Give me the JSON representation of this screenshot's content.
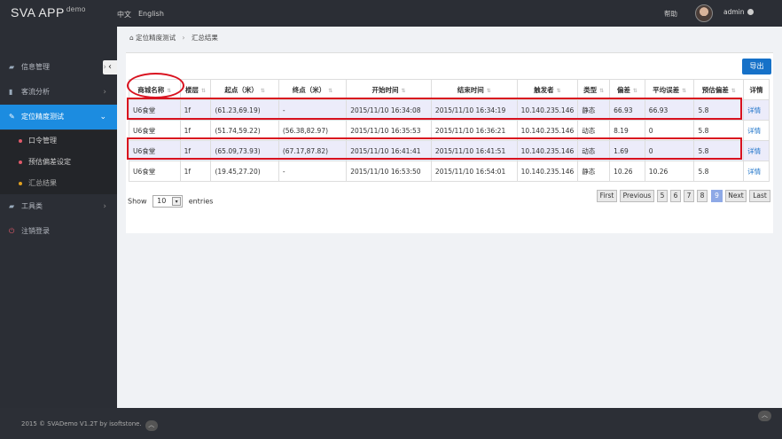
{
  "app": {
    "logo": "SVA APP",
    "logo_sup": "demo"
  },
  "topbar": {
    "lang_zh": "中文",
    "lang_en": "English",
    "help": "帮助",
    "user": "admin"
  },
  "sidebar": {
    "collapse_icon": "‹",
    "items": [
      {
        "label": "信息管理",
        "icon": "folder-icon"
      },
      {
        "label": "客流分析",
        "icon": "bar-chart-icon"
      },
      {
        "label": "定位精度测试",
        "icon": "edit-icon"
      },
      {
        "label": "工具类",
        "icon": "folder-icon"
      },
      {
        "label": "注销登录",
        "icon": "power-icon"
      }
    ],
    "subitems": [
      {
        "label": "口令管理",
        "dot": "#e05a6a"
      },
      {
        "label": "预估偏差设定",
        "dot": "#e05a6a"
      },
      {
        "label": "汇总结果",
        "dot": "#e0a020"
      }
    ]
  },
  "breadcrumb": {
    "home": "定位精度测试",
    "current": "汇总结果"
  },
  "toolbar": {
    "export": "导出"
  },
  "table": {
    "headers": [
      "商城名称",
      "楼层",
      "起点（米）",
      "终点（米）",
      "开始时间",
      "结束时间",
      "触发者",
      "类型",
      "偏差",
      "平均误差",
      "预估偏差",
      "详情"
    ],
    "rows": [
      [
        "U6食堂",
        "1f",
        "(61.23,69.19)",
        "-",
        "2015/11/10 16:34:08",
        "2015/11/10 16:34:19",
        "10.140.235.146",
        "静态",
        "66.93",
        "66.93",
        "5.8",
        "详情"
      ],
      [
        "U6食堂",
        "1f",
        "(51.74,59.22)",
        "(56.38,82.97)",
        "2015/11/10 16:35:53",
        "2015/11/10 16:36:21",
        "10.140.235.146",
        "动态",
        "8.19",
        "0",
        "5.8",
        "详情"
      ],
      [
        "U6食堂",
        "1f",
        "(65.09,73.93)",
        "(67.17,87.82)",
        "2015/11/10 16:41:41",
        "2015/11/10 16:41:51",
        "10.140.235.146",
        "动态",
        "1.69",
        "0",
        "5.8",
        "详情"
      ],
      [
        "U6食堂",
        "1f",
        "(19.45,27.20)",
        "-",
        "2015/11/10 16:53:50",
        "2015/11/10 16:54:01",
        "10.140.235.146",
        "静态",
        "10.26",
        "10.26",
        "5.8",
        "详情"
      ]
    ]
  },
  "length": {
    "show": "Show",
    "value": "10",
    "entries": "entries"
  },
  "pagination": {
    "first": "First",
    "previous": "Previous",
    "pages": [
      "5",
      "6",
      "7",
      "8",
      "9"
    ],
    "current": "9",
    "next": "Next",
    "last": "Last"
  },
  "footer": {
    "text": "2015 © SVADemo V1.2T by isoftstone."
  },
  "colors": {
    "accent": "#1c8ce0",
    "export": "#1671c8",
    "highlight": "#d9121f"
  }
}
